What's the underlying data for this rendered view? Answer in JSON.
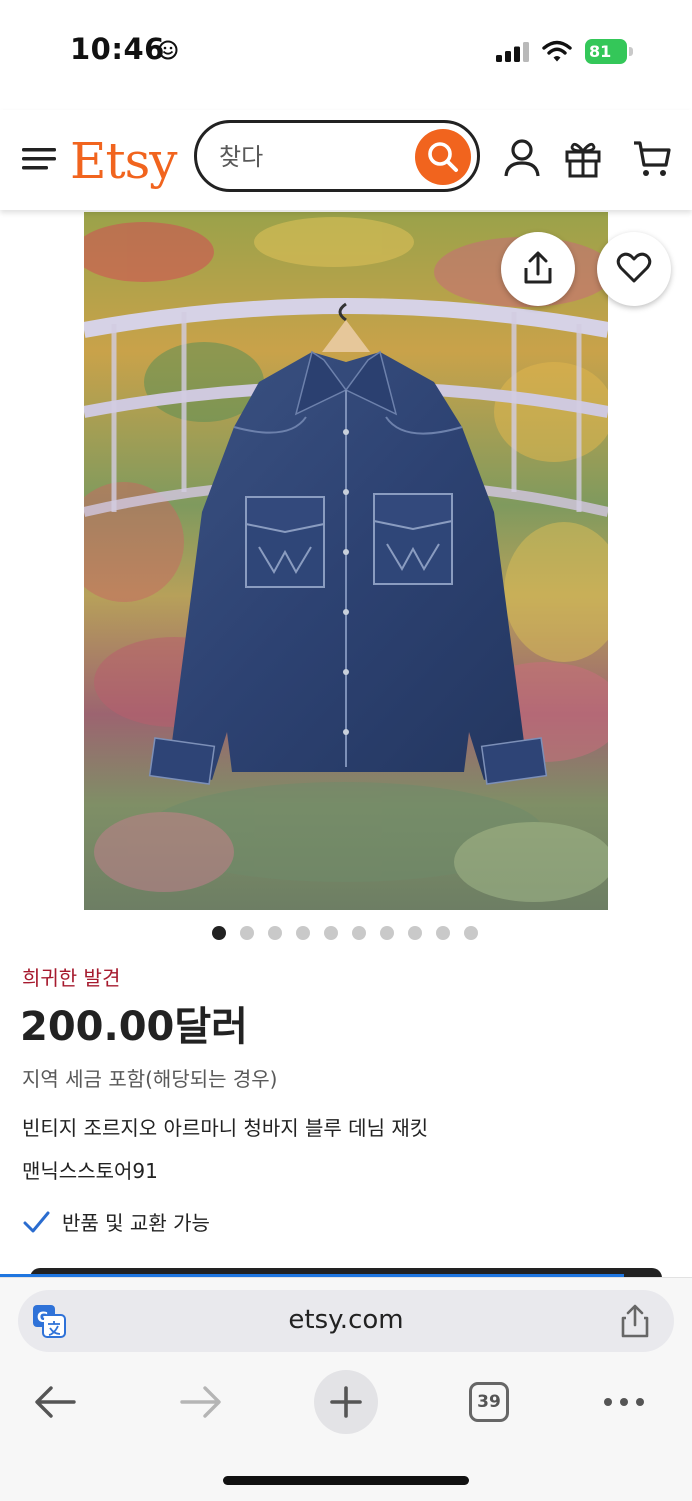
{
  "status_bar": {
    "time": "10:46",
    "battery": "81"
  },
  "header": {
    "logo": "Etsy",
    "search_placeholder": "찾다",
    "brand_color": "#f1641e"
  },
  "image_carousel": {
    "count": 10,
    "active_index": 0
  },
  "listing": {
    "badge": "희귀한 발견",
    "price": "200.00달러",
    "tax_note": "지역 세금 포함(해당되는 경우)",
    "title": "빈티지 조르지오 아르마니 청바지 블루 데님 재킷",
    "shop": "맨닉스스토어91",
    "returns": "반품 및 교환 가능"
  },
  "browser": {
    "url": "etsy.com",
    "tab_count": "39"
  },
  "icons": [
    "smiley-icon",
    "signal-icon",
    "wifi-icon",
    "battery-icon",
    "menu-icon",
    "search-icon",
    "user-icon",
    "gift-icon",
    "cart-icon",
    "share-icon",
    "heart-icon",
    "check-icon",
    "translate-icon",
    "back-arrow-icon",
    "forward-arrow-icon",
    "plus-icon",
    "more-icon"
  ]
}
